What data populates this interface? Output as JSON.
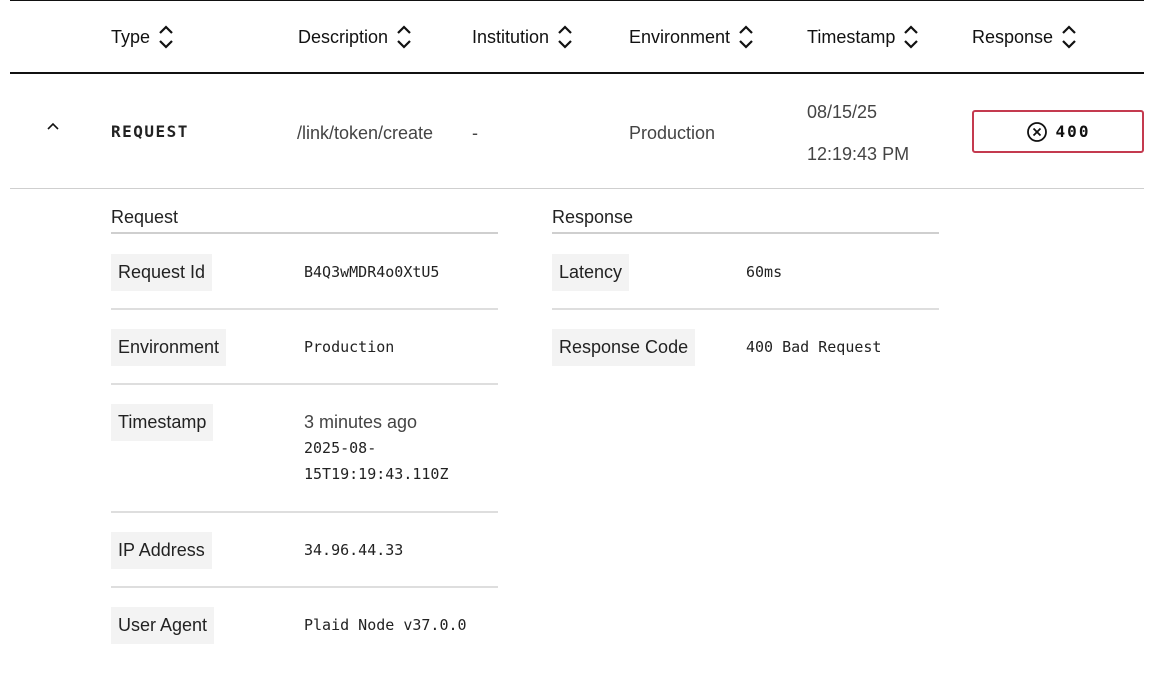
{
  "header": {
    "columns": [
      "Type",
      "Description",
      "Institution",
      "Environment",
      "Timestamp",
      "Response"
    ]
  },
  "row": {
    "type": "REQUEST",
    "description": "/link/token/create",
    "institution": "-",
    "environment": "Production",
    "timestamp_date": "08/15/25",
    "timestamp_time": "12:19:43 PM",
    "response_code": "400",
    "response_icon": "error-circle-x-icon",
    "expand_icon": "chevron-up-icon"
  },
  "request_panel": {
    "title": "Request",
    "request_id_label": "Request Id",
    "request_id": "B4Q3wMDR4o0XtU5",
    "environment_label": "Environment",
    "environment": "Production",
    "timestamp_label": "Timestamp",
    "timestamp_relative": "3 minutes ago",
    "timestamp_iso_line1": "2025-08-",
    "timestamp_iso_line2": "15T19:19:43.110Z",
    "ip_label": "IP Address",
    "ip": "34.96.44.33",
    "user_agent_label": "User Agent",
    "user_agent": "Plaid Node v37.0.0"
  },
  "response_panel": {
    "title": "Response",
    "latency_label": "Latency",
    "latency": "60ms",
    "response_code_label": "Response Code",
    "response_code": "400 Bad Request"
  },
  "colors": {
    "error_border": "#c43a4f",
    "label_bg": "#f3f3f3",
    "rule_dark": "#111111",
    "rule_light": "#dedede"
  }
}
